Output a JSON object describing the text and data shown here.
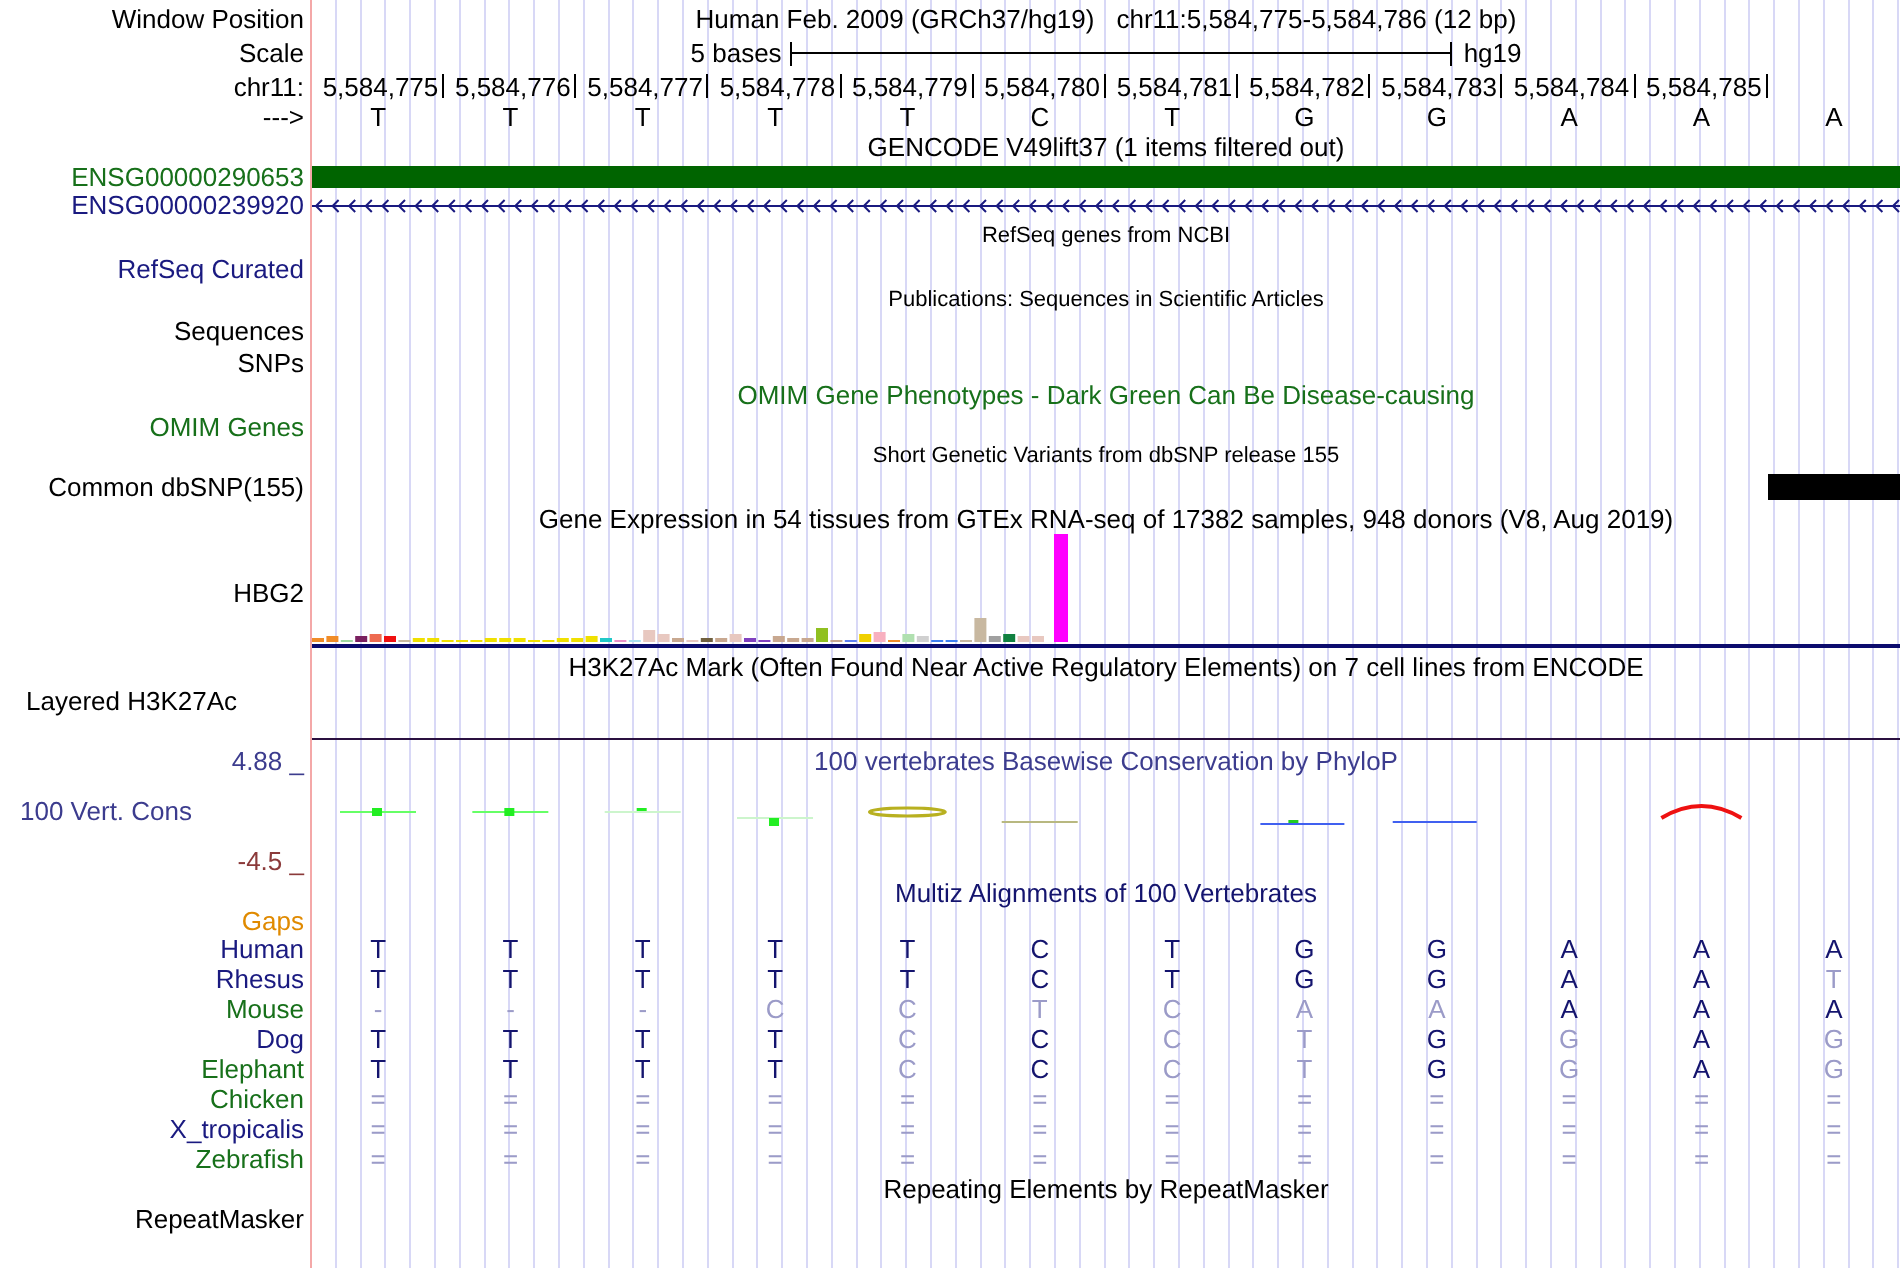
{
  "header": {
    "label": "Window Position",
    "assembly": "Human Feb. 2009 (GRCh37/hg19)",
    "position": "chr11:5,584,775-5,584,786 (12 bp)"
  },
  "scale": {
    "label": "Scale",
    "bar_label": "5 bases",
    "assembly": "hg19"
  },
  "ruler": {
    "label": "chr11:",
    "positions": [
      "5,584,775",
      "5,584,776",
      "5,584,777",
      "5,584,778",
      "5,584,779",
      "5,584,780",
      "5,584,781",
      "5,584,782",
      "5,584,783",
      "5,584,784",
      "5,584,785"
    ]
  },
  "sequence": {
    "label": "--->",
    "bases": [
      "T",
      "T",
      "T",
      "T",
      "T",
      "C",
      "T",
      "G",
      "G",
      "A",
      "A",
      "A"
    ]
  },
  "gencode": {
    "title": "GENCODE V49lift37 (1 items filtered out)",
    "genes": [
      {
        "name": "ENSG00000290653",
        "kind": "block"
      },
      {
        "name": "ENSG00000239920",
        "kind": "strand"
      }
    ]
  },
  "refseq": {
    "title": "RefSeq genes from NCBI",
    "label": "RefSeq Curated"
  },
  "publications": {
    "title": "Publications: Sequences in Scientific Articles",
    "labels": [
      "Sequences",
      "SNPs"
    ]
  },
  "omim": {
    "title": "OMIM Gene Phenotypes - Dark Green Can Be Disease-causing",
    "label": "OMIM Genes"
  },
  "dbsnp": {
    "title": "Short Genetic Variants from dbSNP release 155",
    "label": "Common dbSNP(155)",
    "variants": [
      {
        "kind": "snp"
      }
    ]
  },
  "gtex": {
    "title": "Gene Expression in 54 tissues from GTEx RNA-seq of 17382 samples, 948 donors (V8, Aug 2019)",
    "label": "HBG2"
  },
  "h3k27ac": {
    "title": "H3K27Ac Mark (Often Found Near Active Regulatory Elements) on 7 cell lines from ENCODE",
    "label": "Layered H3K27Ac"
  },
  "phylop": {
    "title": "100 vertebrates Basewise Conservation by PhyloP",
    "label": "100 Vert. Cons",
    "max_label": "4.88 _",
    "min_label": "-4.5 _"
  },
  "multiz": {
    "title": "Multiz Alignments of 100 Vertebrates",
    "gaps_label": "Gaps",
    "species": [
      {
        "name": "Human",
        "color": "#1a1a80",
        "bases": [
          {
            "text": "T",
            "faded": false
          },
          {
            "text": "T",
            "faded": false
          },
          {
            "text": "T",
            "faded": false
          },
          {
            "text": "T",
            "faded": false
          },
          {
            "text": "T",
            "faded": false
          },
          {
            "text": "C",
            "faded": false
          },
          {
            "text": "T",
            "faded": false
          },
          {
            "text": "G",
            "faded": false
          },
          {
            "text": "G",
            "faded": false
          },
          {
            "text": "A",
            "faded": false
          },
          {
            "text": "A",
            "faded": false
          },
          {
            "text": "A",
            "faded": false
          }
        ]
      },
      {
        "name": "Rhesus",
        "color": "#1a1a80",
        "bases": [
          {
            "text": "T",
            "faded": false
          },
          {
            "text": "T",
            "faded": false
          },
          {
            "text": "T",
            "faded": false
          },
          {
            "text": "T",
            "faded": false
          },
          {
            "text": "T",
            "faded": false
          },
          {
            "text": "C",
            "faded": false
          },
          {
            "text": "T",
            "faded": false
          },
          {
            "text": "G",
            "faded": false
          },
          {
            "text": "G",
            "faded": false
          },
          {
            "text": "A",
            "faded": false
          },
          {
            "text": "A",
            "faded": false
          },
          {
            "text": "T",
            "faded": true
          }
        ]
      },
      {
        "name": "Mouse",
        "color": "#17701a",
        "bases": [
          {
            "text": "-",
            "faded": true
          },
          {
            "text": "-",
            "faded": true
          },
          {
            "text": "-",
            "faded": true
          },
          {
            "text": "C",
            "faded": true
          },
          {
            "text": "C",
            "faded": true
          },
          {
            "text": "T",
            "faded": true
          },
          {
            "text": "C",
            "faded": true
          },
          {
            "text": "A",
            "faded": true
          },
          {
            "text": "A",
            "faded": true
          },
          {
            "text": "A",
            "faded": false
          },
          {
            "text": "A",
            "faded": false
          },
          {
            "text": "A",
            "faded": false
          }
        ]
      },
      {
        "name": "Dog",
        "color": "#1a1a80",
        "bases": [
          {
            "text": "T",
            "faded": false
          },
          {
            "text": "T",
            "faded": false
          },
          {
            "text": "T",
            "faded": false
          },
          {
            "text": "T",
            "faded": false
          },
          {
            "text": "C",
            "faded": true
          },
          {
            "text": "C",
            "faded": false
          },
          {
            "text": "C",
            "faded": true
          },
          {
            "text": "T",
            "faded": true
          },
          {
            "text": "G",
            "faded": false
          },
          {
            "text": "G",
            "faded": true
          },
          {
            "text": "A",
            "faded": false
          },
          {
            "text": "G",
            "faded": true
          }
        ]
      },
      {
        "name": "Elephant",
        "color": "#17701a",
        "bases": [
          {
            "text": "T",
            "faded": false
          },
          {
            "text": "T",
            "faded": false
          },
          {
            "text": "T",
            "faded": false
          },
          {
            "text": "T",
            "faded": false
          },
          {
            "text": "C",
            "faded": true
          },
          {
            "text": "C",
            "faded": false
          },
          {
            "text": "C",
            "faded": true
          },
          {
            "text": "T",
            "faded": true
          },
          {
            "text": "G",
            "faded": false
          },
          {
            "text": "G",
            "faded": true
          },
          {
            "text": "A",
            "faded": false
          },
          {
            "text": "G",
            "faded": true
          }
        ]
      },
      {
        "name": "Chicken",
        "color": "#17701a",
        "bases": [
          {
            "text": "=",
            "faded": true
          },
          {
            "text": "=",
            "faded": true
          },
          {
            "text": "=",
            "faded": true
          },
          {
            "text": "=",
            "faded": true
          },
          {
            "text": "=",
            "faded": true
          },
          {
            "text": "=",
            "faded": true
          },
          {
            "text": "=",
            "faded": true
          },
          {
            "text": "=",
            "faded": true
          },
          {
            "text": "=",
            "faded": true
          },
          {
            "text": "=",
            "faded": true
          },
          {
            "text": "=",
            "faded": true
          },
          {
            "text": "=",
            "faded": true
          }
        ]
      },
      {
        "name": "X_tropicalis",
        "color": "#1a1a80",
        "bases": [
          {
            "text": "=",
            "faded": true
          },
          {
            "text": "=",
            "faded": true
          },
          {
            "text": "=",
            "faded": true
          },
          {
            "text": "=",
            "faded": true
          },
          {
            "text": "=",
            "faded": true
          },
          {
            "text": "=",
            "faded": true
          },
          {
            "text": "=",
            "faded": true
          },
          {
            "text": "=",
            "faded": true
          },
          {
            "text": "=",
            "faded": true
          },
          {
            "text": "=",
            "faded": true
          },
          {
            "text": "=",
            "faded": true
          },
          {
            "text": "=",
            "faded": true
          }
        ]
      },
      {
        "name": "Zebrafish",
        "color": "#17701a",
        "bases": [
          {
            "text": "=",
            "faded": true
          },
          {
            "text": "=",
            "faded": true
          },
          {
            "text": "=",
            "faded": true
          },
          {
            "text": "=",
            "faded": true
          },
          {
            "text": "=",
            "faded": true
          },
          {
            "text": "=",
            "faded": true
          },
          {
            "text": "=",
            "faded": true
          },
          {
            "text": "=",
            "faded": true
          },
          {
            "text": "=",
            "faded": true
          },
          {
            "text": "=",
            "faded": true
          },
          {
            "text": "=",
            "faded": true
          },
          {
            "text": "=",
            "faded": true
          }
        ]
      }
    ]
  },
  "repeatmasker": {
    "title": "Repeating Elements by RepeatMasker",
    "label": "RepeatMasker"
  }
}
